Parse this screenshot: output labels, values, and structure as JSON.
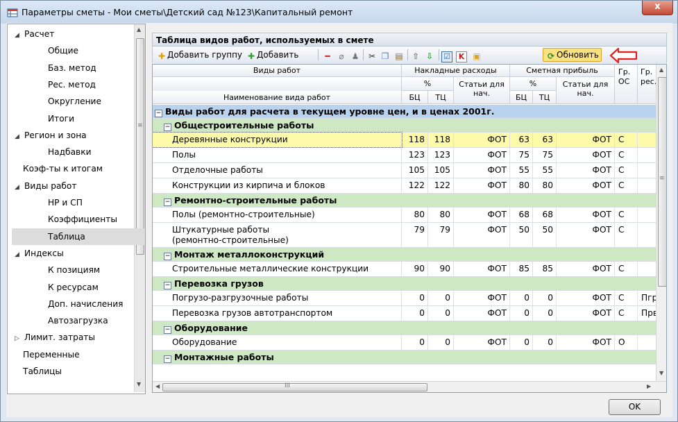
{
  "window": {
    "title": "Параметры сметы - Мои сметы\\Детский сад №123\\Капитальный ремонт",
    "close_label": "x"
  },
  "tree": {
    "items": [
      {
        "label": "Расчет",
        "level": 0,
        "expander": "expanded"
      },
      {
        "label": "Общие",
        "level": 1
      },
      {
        "label": "Баз. метод",
        "level": 1
      },
      {
        "label": "Рес. метод",
        "level": 1
      },
      {
        "label": "Округление",
        "level": 1
      },
      {
        "label": "Итоги",
        "level": 1
      },
      {
        "label": "Регион и зона",
        "level": 0,
        "expander": "expanded"
      },
      {
        "label": "Надбавки",
        "level": 1
      },
      {
        "label": "Коэф-ты к итогам",
        "level": 0
      },
      {
        "label": "Виды работ",
        "level": 0,
        "expander": "expanded"
      },
      {
        "label": "НР и СП",
        "level": 1
      },
      {
        "label": "Коэффициенты",
        "level": 1
      },
      {
        "label": "Таблица",
        "level": 1,
        "selected": true
      },
      {
        "label": "Индексы",
        "level": 0,
        "expander": "expanded"
      },
      {
        "label": "К позициям",
        "level": 1
      },
      {
        "label": "К ресурсам",
        "level": 1
      },
      {
        "label": "Доп. начисления",
        "level": 1
      },
      {
        "label": "Автозагрузка",
        "level": 1
      },
      {
        "label": "Лимит. затраты",
        "level": 0,
        "expander": "collapsed"
      },
      {
        "label": "Переменные",
        "level": 0
      },
      {
        "label": "Таблицы",
        "level": 0
      }
    ]
  },
  "panel": {
    "title": "Таблица видов работ, используемых в смете"
  },
  "toolbar": {
    "add_group": "Добавить группу",
    "add": "Добавить",
    "refresh": "Обновить"
  },
  "grid": {
    "headers": {
      "work_types": "Виды работ",
      "work_name": "Наименование вида работ",
      "overhead": "Накладные расходы",
      "profit": "Сметная прибыль",
      "percent": "%",
      "items_for": "Статьи для нач.",
      "bc": "БЦ",
      "tc": "ТЦ",
      "gr_os": "Гр. ОС",
      "gr_res": "Гр. рес."
    },
    "rows": [
      {
        "kind": "group0",
        "name": "Виды работ для расчета в текущем уровне цен, и в ценах 2001г."
      },
      {
        "kind": "group1",
        "name": "Общестроительные работы"
      },
      {
        "kind": "data",
        "name": "Деревянные конструкции",
        "nr_bc": "118",
        "nr_tc": "118",
        "nr_items": "ФОТ",
        "sp_bc": "63",
        "sp_tc": "63",
        "sp_items": "ФОТ",
        "gr_os": "С",
        "gr_res": "",
        "highlight": true
      },
      {
        "kind": "data",
        "name": "Полы",
        "nr_bc": "123",
        "nr_tc": "123",
        "nr_items": "ФОТ",
        "sp_bc": "75",
        "sp_tc": "75",
        "sp_items": "ФОТ",
        "gr_os": "С",
        "gr_res": ""
      },
      {
        "kind": "data",
        "name": "Отделочные работы",
        "nr_bc": "105",
        "nr_tc": "105",
        "nr_items": "ФОТ",
        "sp_bc": "55",
        "sp_tc": "55",
        "sp_items": "ФОТ",
        "gr_os": "С",
        "gr_res": ""
      },
      {
        "kind": "data",
        "name": "Конструкции из кирпича и блоков",
        "nr_bc": "122",
        "nr_tc": "122",
        "nr_items": "ФОТ",
        "sp_bc": "80",
        "sp_tc": "80",
        "sp_items": "ФОТ",
        "gr_os": "С",
        "gr_res": ""
      },
      {
        "kind": "group1",
        "name": "Ремонтно-строительные работы"
      },
      {
        "kind": "data",
        "name": "Полы (ремонтно-строительные)",
        "nr_bc": "80",
        "nr_tc": "80",
        "nr_items": "ФОТ",
        "sp_bc": "68",
        "sp_tc": "68",
        "sp_items": "ФОТ",
        "gr_os": "С",
        "gr_res": ""
      },
      {
        "kind": "data2",
        "name": "Штукатурные работы",
        "name2": "(ремонтно-строительные)",
        "nr_bc": "79",
        "nr_tc": "79",
        "nr_items": "ФОТ",
        "sp_bc": "50",
        "sp_tc": "50",
        "sp_items": "ФОТ",
        "gr_os": "С",
        "gr_res": ""
      },
      {
        "kind": "group1",
        "name": "Монтаж металлоконструкций"
      },
      {
        "kind": "data",
        "name": "Строительные металлические конструкции",
        "nr_bc": "90",
        "nr_tc": "90",
        "nr_items": "ФОТ",
        "sp_bc": "85",
        "sp_tc": "85",
        "sp_items": "ФОТ",
        "gr_os": "С",
        "gr_res": ""
      },
      {
        "kind": "group1",
        "name": "Перевозка грузов"
      },
      {
        "kind": "data",
        "name": "Погрузо-разгрузочные работы",
        "nr_bc": "0",
        "nr_tc": "0",
        "nr_items": "ФОТ",
        "sp_bc": "0",
        "sp_tc": "0",
        "sp_items": "ФОТ",
        "gr_os": "С",
        "gr_res": "Пгр"
      },
      {
        "kind": "data",
        "name": "Перевозка грузов автотранспортом",
        "nr_bc": "0",
        "nr_tc": "0",
        "nr_items": "ФОТ",
        "sp_bc": "0",
        "sp_tc": "0",
        "sp_items": "ФОТ",
        "gr_os": "С",
        "gr_res": "Прв"
      },
      {
        "kind": "group1",
        "name": "Оборудование"
      },
      {
        "kind": "data",
        "name": "Оборудование",
        "nr_bc": "0",
        "nr_tc": "0",
        "nr_items": "ФОТ",
        "sp_bc": "0",
        "sp_tc": "0",
        "sp_items": "ФОТ",
        "gr_os": "О",
        "gr_res": ""
      },
      {
        "kind": "group1",
        "name": "Монтажные работы"
      }
    ],
    "hscroll_glyph": "III"
  },
  "footer": {
    "ok_label": "OK"
  },
  "colors": {
    "group0_bg": "#b9d3ee",
    "group1_bg": "#cfe8c4",
    "highlight_bg": "#fdfaaa",
    "refresh_bg": "#fbe281",
    "arrow_red": "#e02020"
  }
}
